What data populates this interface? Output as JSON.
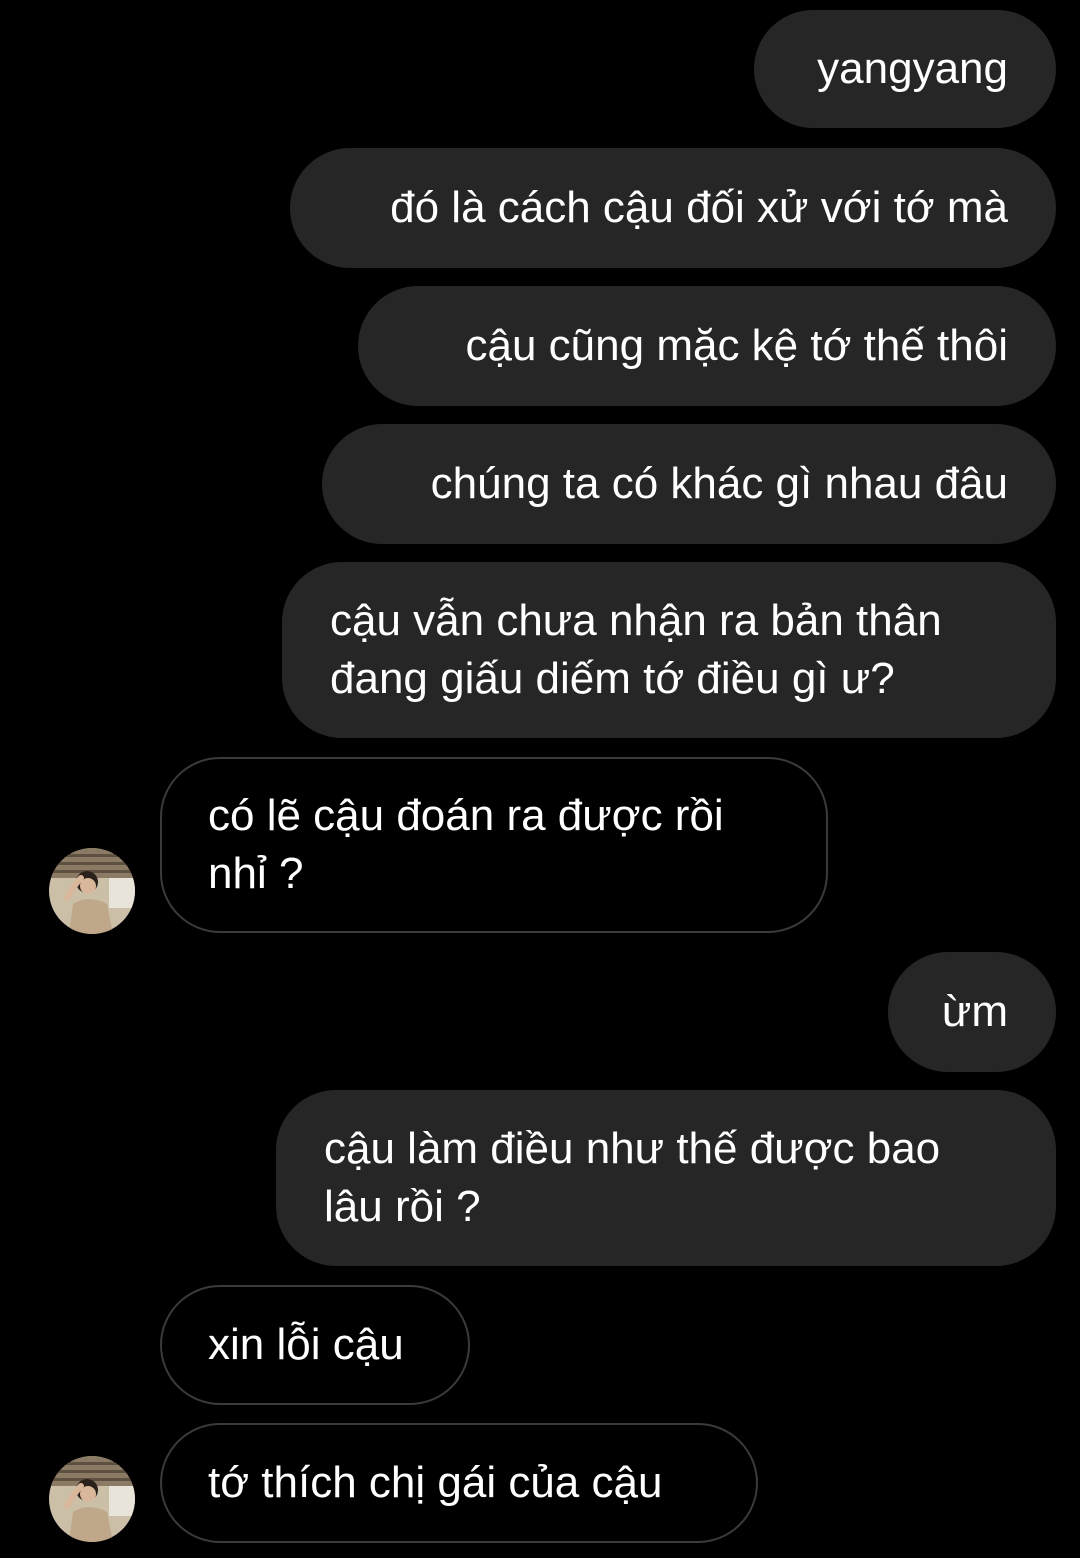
{
  "colors": {
    "background": "#000000",
    "outgoing_bubble": "#262626",
    "incoming_border": "#3a3a3a",
    "text": "#ffffff"
  },
  "messages": [
    {
      "direction": "outgoing",
      "text": "yangyang"
    },
    {
      "direction": "outgoing",
      "text": "đó là cách cậu đối xử với tớ mà"
    },
    {
      "direction": "outgoing",
      "text": "cậu cũng mặc kệ tớ thế thôi"
    },
    {
      "direction": "outgoing",
      "text": "chúng ta có khác gì nhau đâu"
    },
    {
      "direction": "outgoing",
      "text": "cậu vẫn chưa nhận ra bản thân\nđang giấu diếm tớ điều gì ư?"
    },
    {
      "direction": "incoming",
      "text": "có lẽ cậu đoán ra được rồi\nnhỉ ?",
      "avatar": "contact-avatar"
    },
    {
      "direction": "outgoing",
      "text": "ừm"
    },
    {
      "direction": "outgoing",
      "text": "cậu làm điều như thế được bao\nlâu rồi ?"
    },
    {
      "direction": "incoming",
      "text": "xin lỗi cậu"
    },
    {
      "direction": "incoming",
      "text": "tớ thích chị gái của cậu",
      "avatar": "contact-avatar"
    }
  ]
}
